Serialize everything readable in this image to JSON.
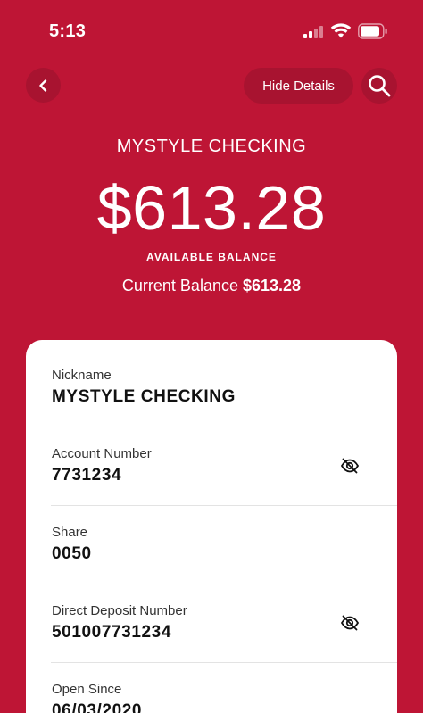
{
  "status_bar": {
    "time": "5:13",
    "icons": [
      "cellular-signal-icon",
      "wifi-icon",
      "battery-icon"
    ]
  },
  "nav": {
    "back_icon": "chevron-left-icon",
    "hide_details_label": "Hide Details",
    "search_icon": "search-icon"
  },
  "account": {
    "name": "MYSTYLE CHECKING",
    "available_balance": "$613.28",
    "available_balance_label": "AVAILABLE BALANCE",
    "current_balance_label": "Current Balance",
    "current_balance_value": "$613.28"
  },
  "details": [
    {
      "label": "Nickname",
      "value": "MYSTYLE CHECKING",
      "icon": ""
    },
    {
      "label": "Account Number",
      "value": "7731234",
      "icon": "eye-off-icon"
    },
    {
      "label": "Share",
      "value": "0050",
      "icon": ""
    },
    {
      "label": "Direct Deposit Number",
      "value": "501007731234",
      "icon": "eye-off-icon"
    },
    {
      "label": "Open Since",
      "value": "06/03/2020",
      "icon": ""
    }
  ],
  "colors": {
    "brand_red": "#be1535",
    "button_red": "#a81330",
    "card_background": "#ffffff"
  }
}
